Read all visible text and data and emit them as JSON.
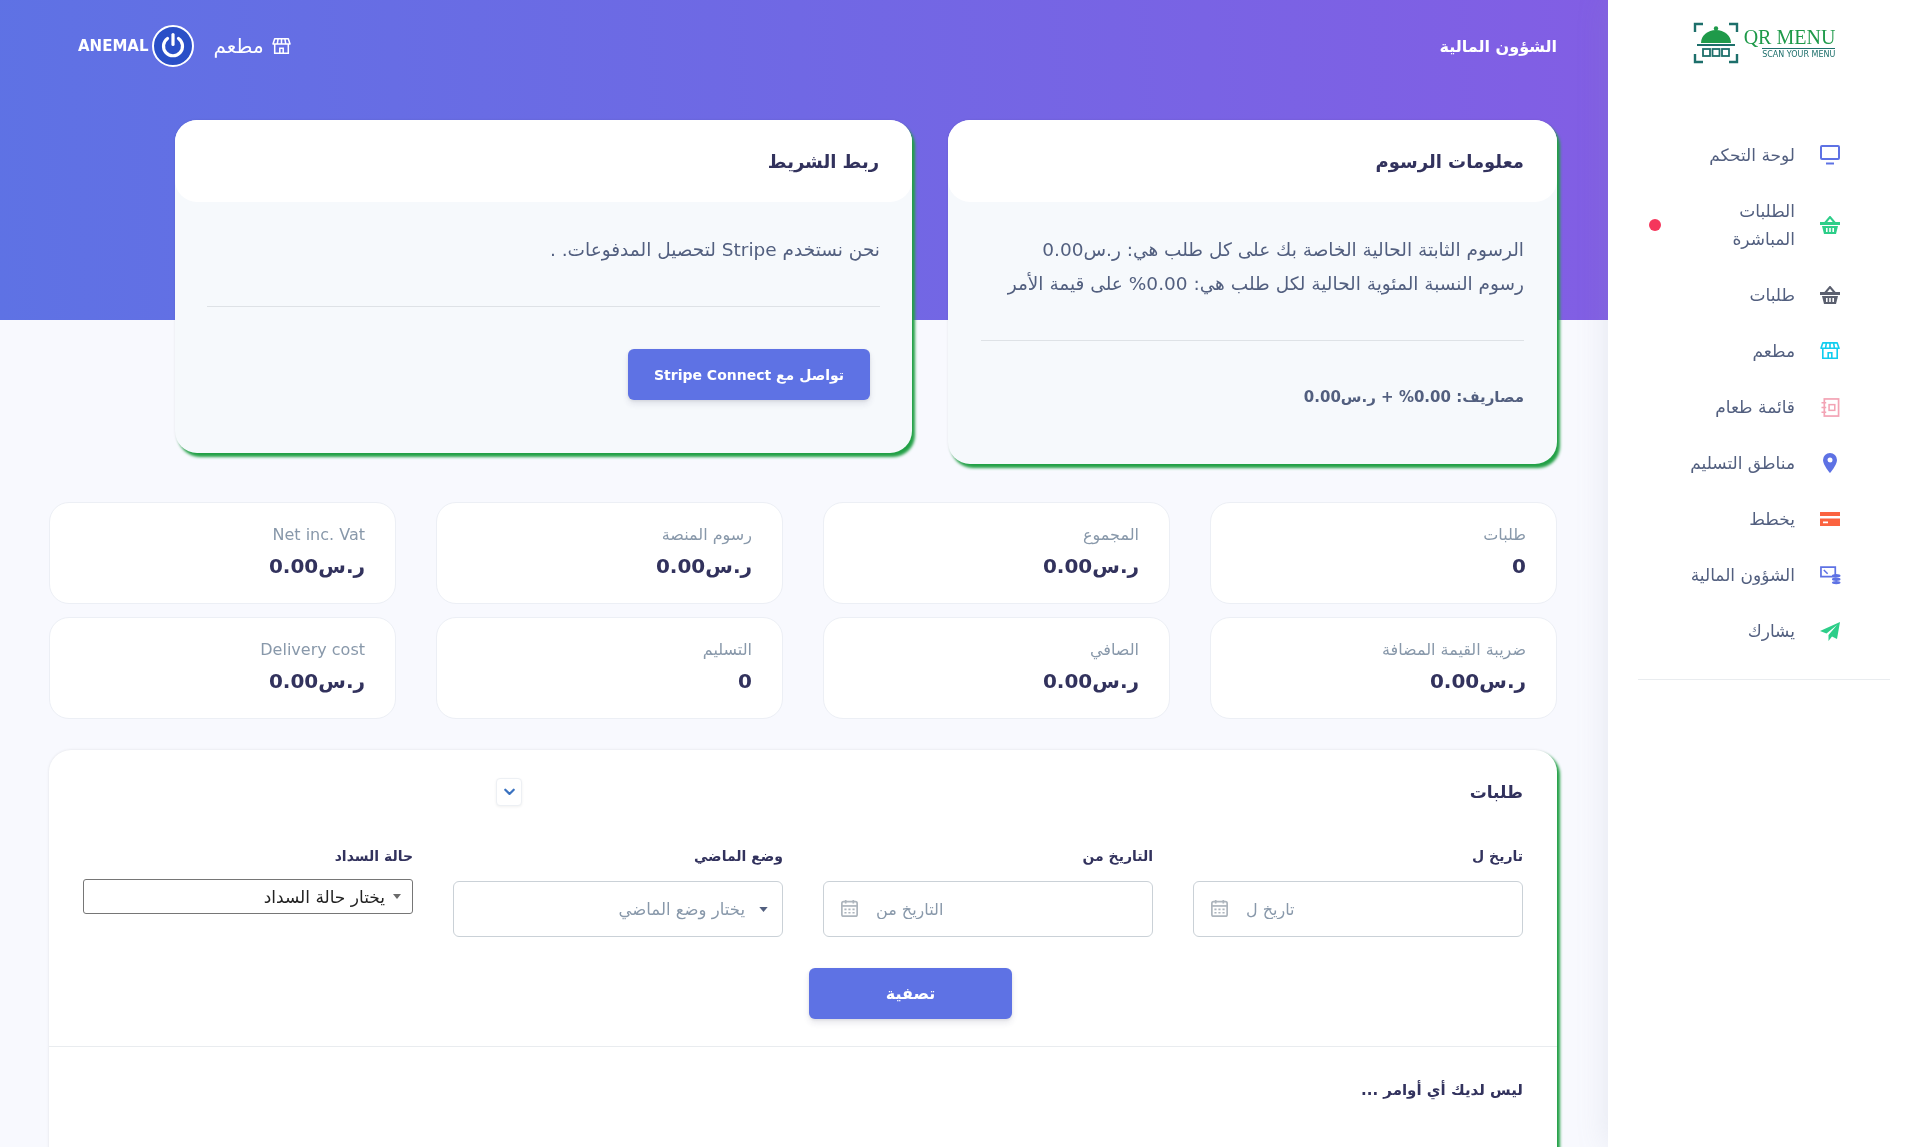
{
  "sidebar": {
    "logo": {
      "title": "QR MENU",
      "tagline": "SCAN YOUR MENU"
    },
    "items": [
      {
        "label": "لوحة التحكم",
        "color": "#5e72e4",
        "notification": false
      },
      {
        "label": "الطلبات المباشرة",
        "color": "#2dce89",
        "notification": true
      },
      {
        "label": "طلبات",
        "color": "#5a5f6e",
        "notification": false
      },
      {
        "label": "مطعم",
        "color": "#11cdef",
        "notification": false
      },
      {
        "label": "قائمة طعام",
        "color": "#f3a4b5",
        "notification": false
      },
      {
        "label": "مناطق التسليم",
        "color": "#5e72e4",
        "notification": false
      },
      {
        "label": "يخطط",
        "color": "#fb6340",
        "notification": false
      },
      {
        "label": "الشؤون المالية",
        "color": "#5e72e4",
        "notification": false
      },
      {
        "label": "يشارك",
        "color": "#2dce89",
        "notification": false
      }
    ]
  },
  "header": {
    "title": "الشؤون المالية",
    "restaurant_link": "مطعم",
    "user_name": "ANEMAL"
  },
  "fees_card": {
    "title": "معلومات الرسوم",
    "lines": [
      "الرسوم الثابتة الحالية الخاصة بك على كل طلب هي: ر.س0.00",
      "رسوم النسبة المئوية الحالية لكل طلب هي: 0.00% على قيمة الأمر"
    ],
    "summary": "مصاريف: 0.00% + ر.س0.00"
  },
  "stripe_card": {
    "title": "ربط الشريط",
    "text": "نحن نستخدم Stripe لتحصيل المدفوعات. .",
    "button": "تواصل مع Stripe Connect"
  },
  "stats": [
    {
      "label": "طلبات",
      "value": "0"
    },
    {
      "label": "المجموع",
      "value": "ر.س0.00"
    },
    {
      "label": "رسوم المنصة",
      "value": "ر.س0.00"
    },
    {
      "label": "Net inc. Vat",
      "value": "ر.س0.00"
    },
    {
      "label": "ضريبة القيمة المضافة",
      "value": "ر.س0.00"
    },
    {
      "label": "الصافي",
      "value": "ر.س0.00"
    },
    {
      "label": "التسليم",
      "value": "0"
    },
    {
      "label": "Delivery cost",
      "value": "ر.س0.00"
    }
  ],
  "orders": {
    "title": "طلبات",
    "filters": [
      {
        "kind": "date",
        "label": "تاريخ ل",
        "placeholder": "تاريخ ل"
      },
      {
        "kind": "date",
        "label": "التاريخ من",
        "placeholder": "التاريخ من"
      },
      {
        "kind": "select",
        "label": "وضع الماضي",
        "placeholder": "يختار وضع الماضي"
      },
      {
        "kind": "native_select",
        "label": "حالة السداد",
        "value": "يختار حالة السداد"
      }
    ],
    "filter_button": "تصفية",
    "empty_message": "ليس لديك أي أوامر ..."
  }
}
